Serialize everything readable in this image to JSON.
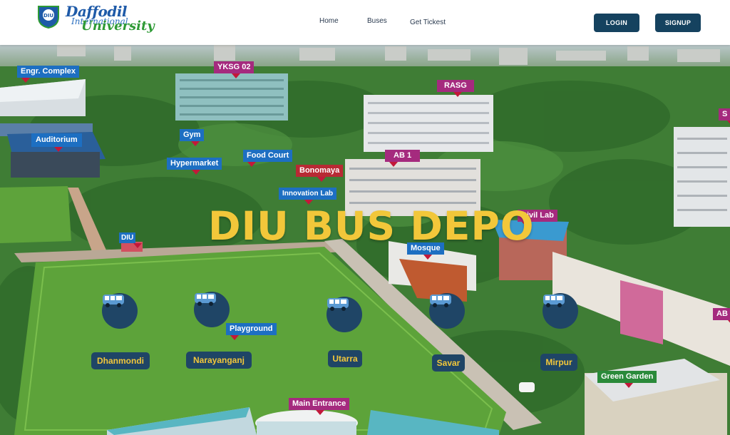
{
  "brand": {
    "name": "Daffodil",
    "middle": "International",
    "university": "University",
    "crest_text": "DIU"
  },
  "nav": {
    "home": "Home",
    "buses": "Buses",
    "tickets": "Get Tickest"
  },
  "auth": {
    "login": "LOGIN",
    "signup": "SIGNUP"
  },
  "hero": {
    "title": "DIU BUS DEPO"
  },
  "places": {
    "engr_complex": "Engr. Complex",
    "yksg": "YKSG 02",
    "rasg": "RASG",
    "auditorium": "Auditorium",
    "gym": "Gym",
    "food_court": "Food Court",
    "hypermarket": "Hypermarket",
    "bonomaya": "Bonomaya",
    "ab1": "AB 1",
    "innovation_lab": "Innovation Lab",
    "civil_lab": "Civil Lab",
    "mosque": "Mosque",
    "playground": "Playground",
    "green_garden": "Green Garden",
    "main_entrance": "Main Entrance",
    "edge_top": "S",
    "edge_right": "AB",
    "diu_sign": "DIU"
  },
  "stops": [
    {
      "name": "Dhanmondi",
      "icon": "bus-icon"
    },
    {
      "name": "Narayanganj",
      "icon": "bus-icon"
    },
    {
      "name": "Utarra",
      "icon": "bus-icon"
    },
    {
      "name": "Savar",
      "icon": "bus-icon"
    },
    {
      "name": "Mirpur",
      "icon": "bus-icon"
    }
  ],
  "colors": {
    "header_bg": "#ffffff",
    "button_bg": "#15425f",
    "title_yellow": "#f2c73a",
    "stop_bg": "#1f4566",
    "field_green": "#5da33a"
  }
}
